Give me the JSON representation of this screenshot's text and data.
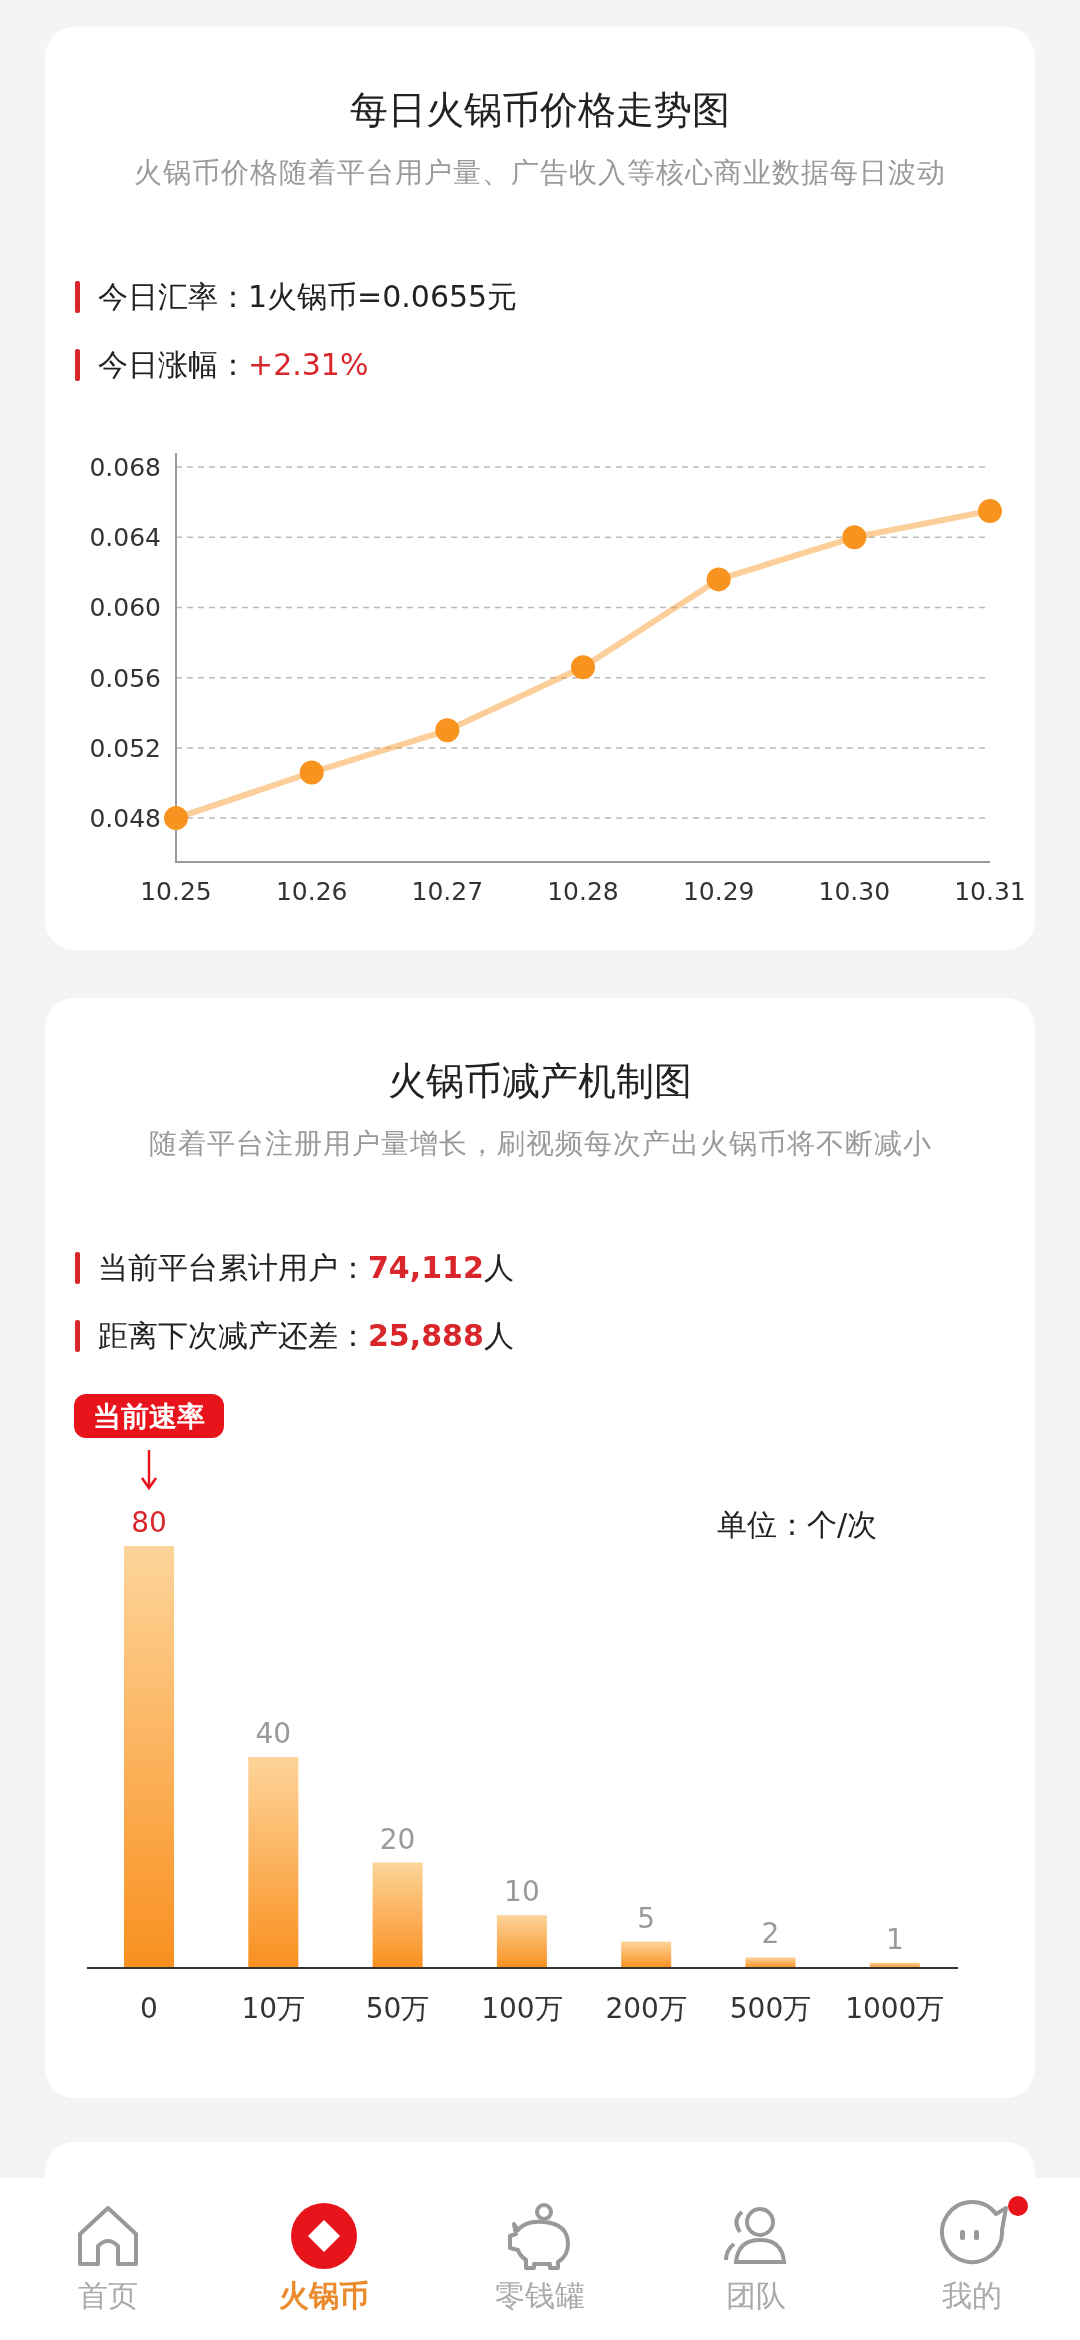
{
  "price_card": {
    "title": "每日火锅币价格走势图",
    "subtitle": "火锅币价格随着平台用户量、广告收入等核心商业数据每日波动",
    "rows": [
      {
        "label": "今日汇率：",
        "value": "1火锅币=0.0655元",
        "kind": "plain"
      },
      {
        "label": "今日涨幅：",
        "value": "+2.31%",
        "kind": "red"
      }
    ],
    "chart_data": {
      "type": "line",
      "categories": [
        "10.25",
        "10.26",
        "10.27",
        "10.28",
        "10.29",
        "10.30",
        "10.31"
      ],
      "grid": true,
      "series": [
        {
          "color": "#f7931e",
          "marker": "circle",
          "values": [
            0.048,
            0.0506,
            0.053,
            0.0566,
            0.0616,
            0.064,
            0.0655
          ]
        }
      ],
      "ylim": [
        0.0455,
        0.0688
      ],
      "yticks": [
        {
          "value": 0.048,
          "label": "0.048"
        },
        {
          "value": 0.052,
          "label": "0.052"
        },
        {
          "value": 0.056,
          "label": "0.056"
        },
        {
          "value": 0.06,
          "label": "0.060"
        },
        {
          "value": 0.064,
          "label": "0.064"
        },
        {
          "value": 0.068,
          "label": "0.068"
        }
      ]
    }
  },
  "output_card": {
    "title": "火锅币减产机制图",
    "subtitle": "随着平台注册用户量增长，刷视频每次产出火锅币将不断减小",
    "rows": [
      {
        "label": "当前平台累计用户：",
        "value": "74,112",
        "unit": "人",
        "kind": "red-bold"
      },
      {
        "label": "距离下次减产还差：",
        "value": "25,888",
        "unit": "人",
        "kind": "red-bold"
      }
    ],
    "unit_label": "单位：个/次",
    "chart_data": {
      "type": "bar",
      "categories": [
        "0",
        "10万",
        "50万",
        "100万",
        "200万",
        "500万",
        "1000万"
      ],
      "values": [
        80,
        40,
        20,
        10,
        5,
        2,
        1
      ],
      "value_labels": [
        "80",
        "40",
        "20",
        "10",
        "5",
        "2",
        "1"
      ],
      "data_labels": true,
      "annotations": [
        {
          "x": "0",
          "text": "当前速率"
        }
      ]
    }
  },
  "tab_bar": {
    "items": [
      {
        "label": "首页",
        "kind": "home",
        "selected": false
      },
      {
        "label": "火锅币",
        "kind": "coin",
        "selected": true
      },
      {
        "label": "零钱罐",
        "kind": "piggy",
        "selected": false
      },
      {
        "label": "团队",
        "kind": "team",
        "selected": false
      },
      {
        "label": "我的",
        "kind": "me",
        "selected": false,
        "dot": true
      }
    ]
  }
}
